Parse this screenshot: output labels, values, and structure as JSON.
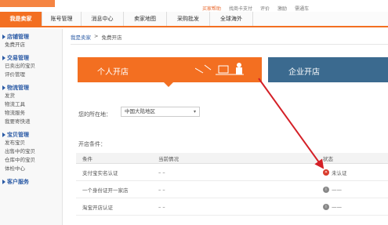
{
  "top_links": [
    "买家帮助",
    "找商卡支付",
    "评价",
    "激励",
    "需通车"
  ],
  "nav_tabs": [
    "我是卖家",
    "账号管理",
    "消息中心",
    "卖家地图",
    "采购批发",
    "全球海外"
  ],
  "sidebar": [
    {
      "title": "店铺管理",
      "items": [
        "免费开店"
      ]
    },
    {
      "title": "交易管理",
      "items": [
        "已卖出的宝贝",
        "评价管理"
      ]
    },
    {
      "title": "物流管理",
      "items": [
        "发货",
        "物流工具",
        "物流服务",
        "我要寄快递"
      ]
    },
    {
      "title": "宝贝管理",
      "items": [
        "发布宝贝",
        "出售中的宝贝",
        "仓库中的宝贝",
        "体检中心"
      ]
    },
    {
      "title": "客户服务",
      "items": []
    }
  ],
  "breadcrumb": {
    "home": "我是卖家",
    "sep": ">",
    "current": "免费开店"
  },
  "cards": {
    "personal": "个人开店",
    "company": "企业开店"
  },
  "region": {
    "label": "您的所在地：",
    "value": "中国大陆地区"
  },
  "conditions_title": "开店条件：",
  "table": {
    "headers": [
      "条件",
      "当前情况",
      "状态"
    ],
    "rows": [
      {
        "condition": "支付宝实名认证",
        "current": "– –",
        "status": "未认证",
        "status_type": "error"
      },
      {
        "condition": "一个身份证开一家店",
        "current": "– –",
        "status": "——",
        "status_type": "info"
      },
      {
        "condition": "淘宝开店认证",
        "current": "– –",
        "status": "——",
        "status_type": "info"
      }
    ]
  },
  "colors": {
    "accent": "#f36f21",
    "company": "#3b6a8f",
    "annotation_arrow": "#d42027",
    "link": "#2a5aa5"
  }
}
